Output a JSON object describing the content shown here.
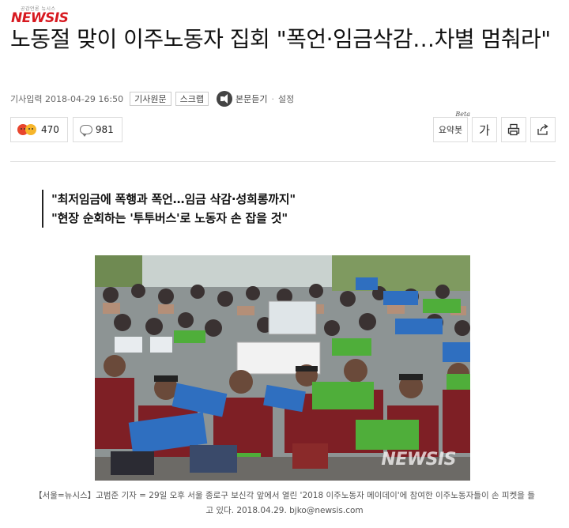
{
  "header": {
    "logo_tagline": "공감언론 뉴시스",
    "logo_text": "NEWSIS"
  },
  "article": {
    "title": "노동절 맞이 이주노동자 집회 \"폭언·임금삭감…차별 멈춰라\"",
    "published_label": "기사입력 2018-04-29 16:50",
    "source_button": "기사원문",
    "scrap_button": "스크랩",
    "listen_label": "본문듣기",
    "settings_label": "설정",
    "subheadlines": [
      "\"최저임금에 폭행과 폭언…임금 삭감·성희롱까지\"",
      "\"현장 순회하는 '투투버스'로 노동자 손 잡을 것\""
    ],
    "photo_watermark": "NEWSIS",
    "caption": "【서울=뉴시스】고범준 기자 = 29일 오후 서울 종로구 보신각 앞에서 열린 '2018 이주노동자 메이데이'에 참여한 이주노동자들이 손 피켓을 들고 있다. 2018.04.29. bjko@newsis.com"
  },
  "reactions": {
    "emotion_count": "470",
    "comment_count": "981"
  },
  "tools": {
    "summary_label": "요약봇",
    "summary_badge": "Beta",
    "font_size_label": "가"
  },
  "icons": [
    "speaker-icon",
    "angry-emoji-icon",
    "surprised-emoji-icon",
    "comment-bubble-icon",
    "print-icon",
    "share-icon"
  ],
  "colors": {
    "brand": "#d71920",
    "sign_blue": "#2f6fc0",
    "sign_green": "#4fae3a",
    "vest_maroon": "#7e1f25"
  }
}
